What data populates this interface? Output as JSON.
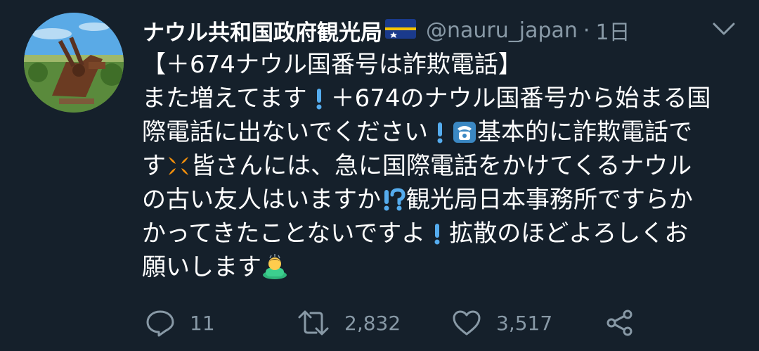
{
  "tweet": {
    "display_name": "ナウル共和国政府観光局",
    "flag_emoji": "nauru-flag",
    "handle": "@nauru_japan",
    "separator": "·",
    "timestamp": "1日",
    "body_lines": [
      "【＋674ナウル国番号は詐欺電話】",
      [
        "また増えてます",
        "！",
        "＋674のナウル国番号から始まる国"
      ],
      [
        "際電話に出ないでください",
        "！",
        "☎",
        "基本的に詐欺電話で"
      ],
      [
        "す",
        "💢",
        "皆さんには、急に国際電話をかけてくるナウル"
      ],
      [
        "の古い友人はいますか",
        "⁉",
        "観光局日本事務所ですらか"
      ],
      [
        "かってきたことないですよ",
        "！",
        "拡散のほどよろしくお"
      ],
      [
        "願いします",
        "🙇"
      ]
    ],
    "actions": {
      "reply_count": "11",
      "retweet_count": "2,832",
      "like_count": "3,517"
    },
    "colors": {
      "background": "#15202b",
      "muted": "#8899a6",
      "text": "#ffffff",
      "accent_blue": "#1da1f2"
    }
  }
}
